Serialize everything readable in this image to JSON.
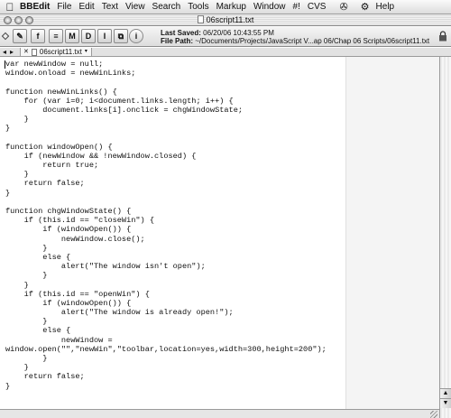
{
  "menubar": {
    "items": [
      "BBEdit",
      "File",
      "Edit",
      "Text",
      "View",
      "Search",
      "Tools",
      "Markup",
      "Window",
      "#!",
      "CVS"
    ],
    "help_label": "Help"
  },
  "window": {
    "title": "06script11.txt"
  },
  "toolbar": {
    "buttons": [
      "f",
      "M",
      "D",
      "I",
      "i"
    ],
    "last_saved_label": "Last Saved:",
    "last_saved_value": "06/20/06 10:43:55 PM",
    "file_path_label": "File Path:",
    "file_path_value": "~/Documents/Projects/JavaScript V...ap 06/Chap 06 Scripts/06script11.txt"
  },
  "tabs": [
    {
      "label": "06script11.txt"
    }
  ],
  "editor": {
    "lines": [
      "var newWindow = null;",
      "window.onload = newWinLinks;",
      "",
      "function newWinLinks() {",
      "    for (var i=0; i<document.links.length; i++) {",
      "        document.links[i].onclick = chgWindowState;",
      "    }",
      "}",
      "",
      "function windowOpen() {",
      "    if (newWindow && !newWindow.closed) {",
      "        return true;",
      "    }",
      "    return false;",
      "}",
      "",
      "function chgWindowState() {",
      "    if (this.id == \"closeWin\") {",
      "        if (windowOpen()) {",
      "            newWindow.close();",
      "        }",
      "        else {",
      "            alert(\"The window isn't open\");",
      "        }",
      "    }",
      "    if (this.id == \"openWin\") {",
      "        if (windowOpen()) {",
      "            alert(\"The window is already open!\");",
      "        }",
      "        else {",
      "            newWindow =",
      "window.open(\"\",\"newWin\",\"toolbar,location=yes,width=300,height=200\");",
      "        }",
      "    }",
      "    return false;",
      "}"
    ]
  }
}
